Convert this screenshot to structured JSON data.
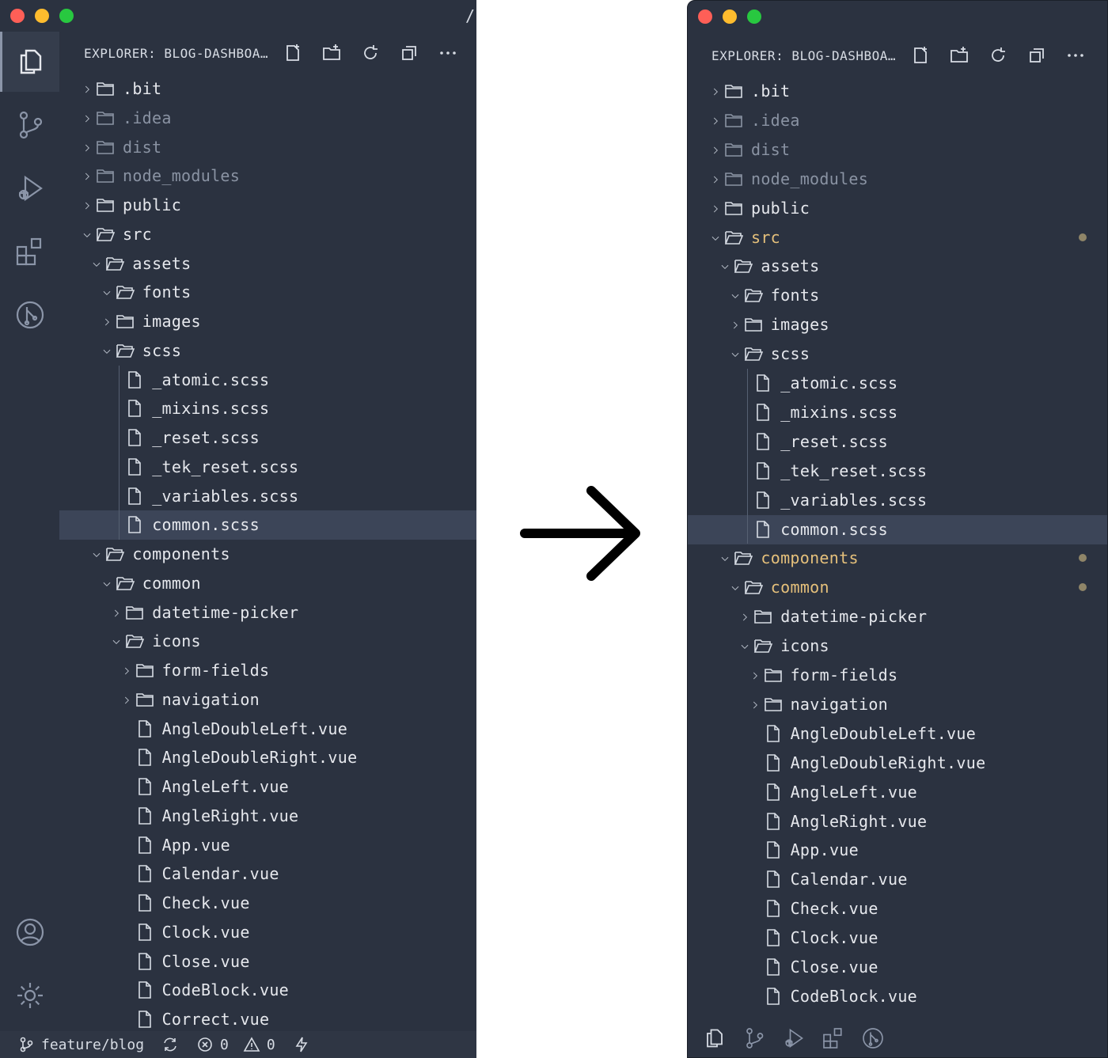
{
  "explorer": {
    "title": "EXPLORER: BLOG-DASHBOA…",
    "actions": [
      "new-file-icon",
      "new-folder-icon",
      "refresh-icon",
      "collapse-all-icon",
      "more-icon"
    ]
  },
  "activity_bar": [
    "explorer-icon",
    "source-control-icon",
    "run-debug-icon",
    "extensions-icon",
    "git-graph-icon"
  ],
  "activity_bottom": [
    "account-icon",
    "settings-gear-icon"
  ],
  "title_fragment": "/",
  "tree": [
    {
      "label": ".bit",
      "type": "folder",
      "depth": 0,
      "open": false
    },
    {
      "label": ".idea",
      "type": "folder",
      "depth": 0,
      "open": false,
      "dim": true
    },
    {
      "label": "dist",
      "type": "folder",
      "depth": 0,
      "open": false,
      "dim": true
    },
    {
      "label": "node_modules",
      "type": "folder",
      "depth": 0,
      "open": false,
      "dim": true
    },
    {
      "label": "public",
      "type": "folder",
      "depth": 0,
      "open": false
    },
    {
      "label": "src",
      "type": "folder",
      "depth": 0,
      "open": true
    },
    {
      "label": "assets",
      "type": "folder",
      "depth": 1,
      "open": true
    },
    {
      "label": "fonts",
      "type": "folder",
      "depth": 2,
      "open": true
    },
    {
      "label": "images",
      "type": "folder",
      "depth": 2,
      "open": false
    },
    {
      "label": "scss",
      "type": "folder",
      "depth": 2,
      "open": true
    },
    {
      "label": "_atomic.scss",
      "type": "file",
      "depth": 3
    },
    {
      "label": "_mixins.scss",
      "type": "file",
      "depth": 3
    },
    {
      "label": "_reset.scss",
      "type": "file",
      "depth": 3
    },
    {
      "label": "_tek_reset.scss",
      "type": "file",
      "depth": 3
    },
    {
      "label": "_variables.scss",
      "type": "file",
      "depth": 3
    },
    {
      "label": "common.scss",
      "type": "file",
      "depth": 3,
      "selected": true
    },
    {
      "label": "components",
      "type": "folder",
      "depth": 1,
      "open": true
    },
    {
      "label": "common",
      "type": "folder",
      "depth": 2,
      "open": true
    },
    {
      "label": "datetime-picker",
      "type": "folder",
      "depth": 3,
      "open": false
    },
    {
      "label": "icons",
      "type": "folder",
      "depth": 3,
      "open": true
    },
    {
      "label": "form-fields",
      "type": "folder",
      "depth": 4,
      "open": false
    },
    {
      "label": "navigation",
      "type": "folder",
      "depth": 4,
      "open": false
    },
    {
      "label": "AngleDoubleLeft.vue",
      "type": "file",
      "depth": 4
    },
    {
      "label": "AngleDoubleRight.vue",
      "type": "file",
      "depth": 4
    },
    {
      "label": "AngleLeft.vue",
      "type": "file",
      "depth": 4
    },
    {
      "label": "AngleRight.vue",
      "type": "file",
      "depth": 4
    },
    {
      "label": "App.vue",
      "type": "file",
      "depth": 4
    },
    {
      "label": "Calendar.vue",
      "type": "file",
      "depth": 4
    },
    {
      "label": "Check.vue",
      "type": "file",
      "depth": 4
    },
    {
      "label": "Clock.vue",
      "type": "file",
      "depth": 4
    },
    {
      "label": "Close.vue",
      "type": "file",
      "depth": 4
    },
    {
      "label": "CodeBlock.vue",
      "type": "file",
      "depth": 4
    },
    {
      "label": "Correct.vue",
      "type": "file",
      "depth": 4
    }
  ],
  "modified_right": [
    "src",
    "components",
    "common"
  ],
  "statusbar": {
    "branch": "feature/blog",
    "errors": "0",
    "warnings": "0"
  },
  "colors": {
    "background": "#2b3240",
    "selected_row": "#3c4558",
    "modified_text": "#e5c07b",
    "dim_text": "#8a93a3"
  }
}
